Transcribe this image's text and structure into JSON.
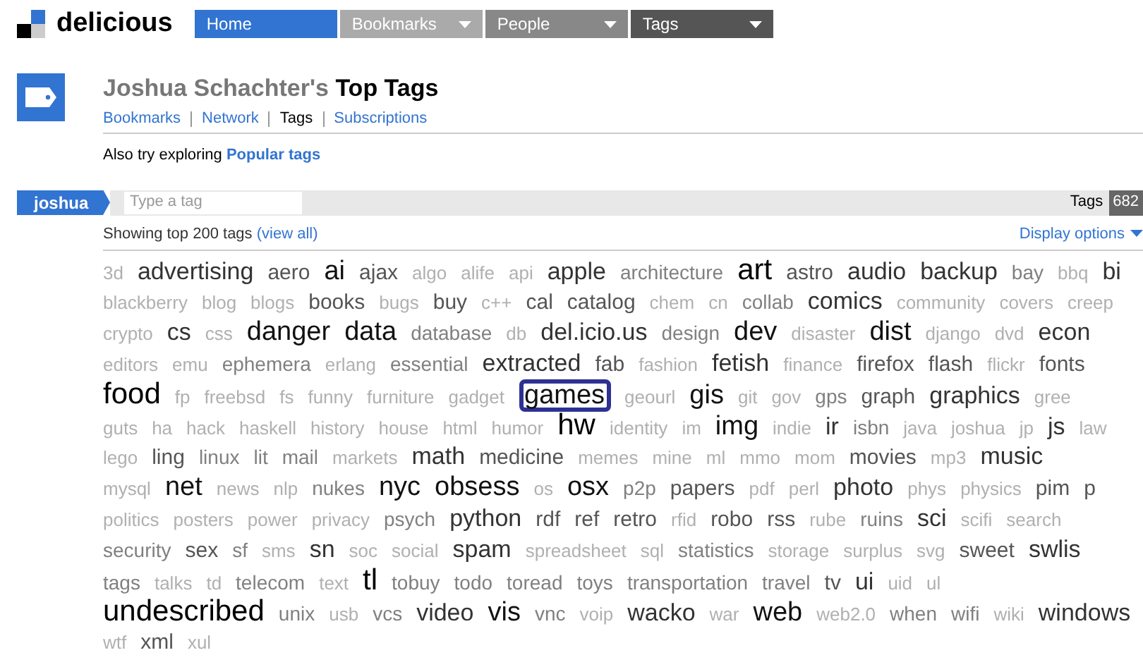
{
  "logo": {
    "text": "delicious"
  },
  "nav": [
    {
      "label": "Home",
      "selected": true,
      "menu": false
    },
    {
      "label": "Bookmarks",
      "selected": false,
      "menu": true
    },
    {
      "label": "People",
      "selected": false,
      "menu": true
    },
    {
      "label": "Tags",
      "selected": false,
      "menu": true
    }
  ],
  "profile": {
    "owner": "Joshua Schachter's",
    "title": "Top Tags"
  },
  "subnav": [
    {
      "label": "Bookmarks",
      "selected": false
    },
    {
      "label": "Network",
      "selected": false
    },
    {
      "label": "Tags",
      "selected": true
    },
    {
      "label": "Subscriptions",
      "selected": false
    }
  ],
  "explore": {
    "text": "Also try exploring",
    "link": "Popular tags"
  },
  "tagbar": {
    "user": "joshua",
    "placeholder": "Type a tag",
    "label": "Tags",
    "count": "682"
  },
  "summary": {
    "text": "Showing top 200 tags",
    "link": "(view all)",
    "options": "Display options"
  },
  "cloud_rows": [
    [
      {
        "text": "3d",
        "kind": "xs",
        "highlighted": false
      },
      {
        "text": "advertising",
        "kind": "l",
        "highlighted": false
      },
      {
        "text": "aero",
        "kind": "m",
        "highlighted": false
      },
      {
        "text": "ai",
        "kind": "xl",
        "highlighted": false
      },
      {
        "text": "ajax",
        "kind": "m",
        "highlighted": false
      },
      {
        "text": "algo",
        "kind": "xs",
        "highlighted": false
      },
      {
        "text": "alife",
        "kind": "xs",
        "highlighted": false
      },
      {
        "text": "api",
        "kind": "xs",
        "highlighted": false
      },
      {
        "text": "apple",
        "kind": "l",
        "highlighted": false
      },
      {
        "text": "architecture",
        "kind": "s",
        "highlighted": false
      },
      {
        "text": "art",
        "kind": "xxl",
        "highlighted": false
      },
      {
        "text": "astro",
        "kind": "m",
        "highlighted": false
      },
      {
        "text": "audio",
        "kind": "l",
        "highlighted": false
      },
      {
        "text": "backup",
        "kind": "l",
        "highlighted": false
      },
      {
        "text": "bay",
        "kind": "s",
        "highlighted": false
      },
      {
        "text": "bbq",
        "kind": "xs",
        "highlighted": false
      },
      {
        "text": "bi",
        "kind": "l",
        "highlighted": false
      }
    ],
    [
      {
        "text": "blackberry",
        "kind": "xs",
        "highlighted": false
      },
      {
        "text": "blog",
        "kind": "xs",
        "highlighted": false
      },
      {
        "text": "blogs",
        "kind": "xs",
        "highlighted": false
      },
      {
        "text": "books",
        "kind": "m",
        "highlighted": false
      },
      {
        "text": "bugs",
        "kind": "xs",
        "highlighted": false
      },
      {
        "text": "buy",
        "kind": "m",
        "highlighted": false
      },
      {
        "text": "c++",
        "kind": "xs",
        "highlighted": false
      },
      {
        "text": "cal",
        "kind": "m",
        "highlighted": false
      },
      {
        "text": "catalog",
        "kind": "m",
        "highlighted": false
      },
      {
        "text": "chem",
        "kind": "xs",
        "highlighted": false
      },
      {
        "text": "cn",
        "kind": "xs",
        "highlighted": false
      },
      {
        "text": "collab",
        "kind": "s",
        "highlighted": false
      },
      {
        "text": "comics",
        "kind": "l",
        "highlighted": false
      },
      {
        "text": "community",
        "kind": "xs",
        "highlighted": false
      },
      {
        "text": "covers",
        "kind": "xs",
        "highlighted": false
      },
      {
        "text": "creep",
        "kind": "xs",
        "highlighted": false
      }
    ],
    [
      {
        "text": "crypto",
        "kind": "xs",
        "highlighted": false
      },
      {
        "text": "cs",
        "kind": "l",
        "highlighted": false
      },
      {
        "text": "css",
        "kind": "xs",
        "highlighted": false
      },
      {
        "text": "danger",
        "kind": "xl",
        "highlighted": false
      },
      {
        "text": "data",
        "kind": "xl",
        "highlighted": false
      },
      {
        "text": "database",
        "kind": "s",
        "highlighted": false
      },
      {
        "text": "db",
        "kind": "xs",
        "highlighted": false
      },
      {
        "text": "del.icio.us",
        "kind": "l",
        "highlighted": false
      },
      {
        "text": "design",
        "kind": "s",
        "highlighted": false
      },
      {
        "text": "dev",
        "kind": "xl",
        "highlighted": false
      },
      {
        "text": "disaster",
        "kind": "xs",
        "highlighted": false
      },
      {
        "text": "dist",
        "kind": "xl",
        "highlighted": false
      },
      {
        "text": "django",
        "kind": "xs",
        "highlighted": false
      },
      {
        "text": "dvd",
        "kind": "xs",
        "highlighted": false
      },
      {
        "text": "econ",
        "kind": "l",
        "highlighted": false
      }
    ],
    [
      {
        "text": "editors",
        "kind": "xs",
        "highlighted": false
      },
      {
        "text": "emu",
        "kind": "xs",
        "highlighted": false
      },
      {
        "text": "ephemera",
        "kind": "s",
        "highlighted": false
      },
      {
        "text": "erlang",
        "kind": "xs",
        "highlighted": false
      },
      {
        "text": "essential",
        "kind": "s",
        "highlighted": false
      },
      {
        "text": "extracted",
        "kind": "l",
        "highlighted": false
      },
      {
        "text": "fab",
        "kind": "m",
        "highlighted": false
      },
      {
        "text": "fashion",
        "kind": "xs",
        "highlighted": false
      },
      {
        "text": "fetish",
        "kind": "l",
        "highlighted": false
      },
      {
        "text": "finance",
        "kind": "xs",
        "highlighted": false
      },
      {
        "text": "firefox",
        "kind": "m",
        "highlighted": false
      },
      {
        "text": "flash",
        "kind": "m",
        "highlighted": false
      },
      {
        "text": "flickr",
        "kind": "xs",
        "highlighted": false
      },
      {
        "text": "fonts",
        "kind": "m",
        "highlighted": false
      }
    ],
    [
      {
        "text": "food",
        "kind": "xxl",
        "highlighted": false
      },
      {
        "text": "fp",
        "kind": "xs",
        "highlighted": false
      },
      {
        "text": "freebsd",
        "kind": "xs",
        "highlighted": false
      },
      {
        "text": "fs",
        "kind": "xs",
        "highlighted": false
      },
      {
        "text": "funny",
        "kind": "xs",
        "highlighted": false
      },
      {
        "text": "furniture",
        "kind": "xs",
        "highlighted": false
      },
      {
        "text": "gadget",
        "kind": "xs",
        "highlighted": false
      },
      {
        "text": "games",
        "kind": "xl",
        "highlighted": true
      },
      {
        "text": "geourl",
        "kind": "xs",
        "highlighted": false
      },
      {
        "text": "gis",
        "kind": "xl",
        "highlighted": false
      },
      {
        "text": "git",
        "kind": "xs",
        "highlighted": false
      },
      {
        "text": "gov",
        "kind": "xs",
        "highlighted": false
      },
      {
        "text": "gps",
        "kind": "s",
        "highlighted": false
      },
      {
        "text": "graph",
        "kind": "m",
        "highlighted": false
      },
      {
        "text": "graphics",
        "kind": "l",
        "highlighted": false
      },
      {
        "text": "gree",
        "kind": "xs",
        "highlighted": false
      }
    ],
    [
      {
        "text": "guts",
        "kind": "xs",
        "highlighted": false
      },
      {
        "text": "ha",
        "kind": "xs",
        "highlighted": false
      },
      {
        "text": "hack",
        "kind": "xs",
        "highlighted": false
      },
      {
        "text": "haskell",
        "kind": "xs",
        "highlighted": false
      },
      {
        "text": "history",
        "kind": "xs",
        "highlighted": false
      },
      {
        "text": "house",
        "kind": "xs",
        "highlighted": false
      },
      {
        "text": "html",
        "kind": "xs",
        "highlighted": false
      },
      {
        "text": "humor",
        "kind": "xs",
        "highlighted": false
      },
      {
        "text": "hw",
        "kind": "xxl",
        "highlighted": false
      },
      {
        "text": "identity",
        "kind": "xs",
        "highlighted": false
      },
      {
        "text": "im",
        "kind": "xs",
        "highlighted": false
      },
      {
        "text": "img",
        "kind": "xl",
        "highlighted": false
      },
      {
        "text": "indie",
        "kind": "xs",
        "highlighted": false
      },
      {
        "text": "ir",
        "kind": "l",
        "highlighted": false
      },
      {
        "text": "isbn",
        "kind": "s",
        "highlighted": false
      },
      {
        "text": "java",
        "kind": "xs",
        "highlighted": false
      },
      {
        "text": "joshua",
        "kind": "xs",
        "highlighted": false
      },
      {
        "text": "jp",
        "kind": "xs",
        "highlighted": false
      },
      {
        "text": "js",
        "kind": "l",
        "highlighted": false
      },
      {
        "text": "law",
        "kind": "xs",
        "highlighted": false
      }
    ],
    [
      {
        "text": "lego",
        "kind": "xs",
        "highlighted": false
      },
      {
        "text": "ling",
        "kind": "m",
        "highlighted": false
      },
      {
        "text": "linux",
        "kind": "s",
        "highlighted": false
      },
      {
        "text": "lit",
        "kind": "s",
        "highlighted": false
      },
      {
        "text": "mail",
        "kind": "s",
        "highlighted": false
      },
      {
        "text": "markets",
        "kind": "xs",
        "highlighted": false
      },
      {
        "text": "math",
        "kind": "l",
        "highlighted": false
      },
      {
        "text": "medicine",
        "kind": "m",
        "highlighted": false
      },
      {
        "text": "memes",
        "kind": "xs",
        "highlighted": false
      },
      {
        "text": "mine",
        "kind": "xs",
        "highlighted": false
      },
      {
        "text": "ml",
        "kind": "xs",
        "highlighted": false
      },
      {
        "text": "mmo",
        "kind": "xs",
        "highlighted": false
      },
      {
        "text": "mom",
        "kind": "xs",
        "highlighted": false
      },
      {
        "text": "movies",
        "kind": "m",
        "highlighted": false
      },
      {
        "text": "mp3",
        "kind": "xs",
        "highlighted": false
      },
      {
        "text": "music",
        "kind": "l",
        "highlighted": false
      }
    ],
    [
      {
        "text": "mysql",
        "kind": "xs",
        "highlighted": false
      },
      {
        "text": "net",
        "kind": "xl",
        "highlighted": false
      },
      {
        "text": "news",
        "kind": "xs",
        "highlighted": false
      },
      {
        "text": "nlp",
        "kind": "xs",
        "highlighted": false
      },
      {
        "text": "nukes",
        "kind": "s",
        "highlighted": false
      },
      {
        "text": "nyc",
        "kind": "xl",
        "highlighted": false
      },
      {
        "text": "obsess",
        "kind": "xl",
        "highlighted": false
      },
      {
        "text": "os",
        "kind": "xs",
        "highlighted": false
      },
      {
        "text": "osx",
        "kind": "xl",
        "highlighted": false
      },
      {
        "text": "p2p",
        "kind": "s",
        "highlighted": false
      },
      {
        "text": "papers",
        "kind": "m",
        "highlighted": false
      },
      {
        "text": "pdf",
        "kind": "xs",
        "highlighted": false
      },
      {
        "text": "perl",
        "kind": "xs",
        "highlighted": false
      },
      {
        "text": "photo",
        "kind": "l",
        "highlighted": false
      },
      {
        "text": "phys",
        "kind": "xs",
        "highlighted": false
      },
      {
        "text": "physics",
        "kind": "xs",
        "highlighted": false
      },
      {
        "text": "pim",
        "kind": "m",
        "highlighted": false
      },
      {
        "text": "p",
        "kind": "m",
        "highlighted": false
      }
    ],
    [
      {
        "text": "politics",
        "kind": "xs",
        "highlighted": false
      },
      {
        "text": "posters",
        "kind": "xs",
        "highlighted": false
      },
      {
        "text": "power",
        "kind": "xs",
        "highlighted": false
      },
      {
        "text": "privacy",
        "kind": "xs",
        "highlighted": false
      },
      {
        "text": "psych",
        "kind": "s",
        "highlighted": false
      },
      {
        "text": "python",
        "kind": "l",
        "highlighted": false
      },
      {
        "text": "rdf",
        "kind": "m",
        "highlighted": false
      },
      {
        "text": "ref",
        "kind": "m",
        "highlighted": false
      },
      {
        "text": "retro",
        "kind": "m",
        "highlighted": false
      },
      {
        "text": "rfid",
        "kind": "xs",
        "highlighted": false
      },
      {
        "text": "robo",
        "kind": "m",
        "highlighted": false
      },
      {
        "text": "rss",
        "kind": "m",
        "highlighted": false
      },
      {
        "text": "rube",
        "kind": "xs",
        "highlighted": false
      },
      {
        "text": "ruins",
        "kind": "s",
        "highlighted": false
      },
      {
        "text": "sci",
        "kind": "l",
        "highlighted": false
      },
      {
        "text": "scifi",
        "kind": "xs",
        "highlighted": false
      },
      {
        "text": "search",
        "kind": "xs",
        "highlighted": false
      }
    ],
    [
      {
        "text": "security",
        "kind": "s",
        "highlighted": false
      },
      {
        "text": "sex",
        "kind": "m",
        "highlighted": false
      },
      {
        "text": "sf",
        "kind": "s",
        "highlighted": false
      },
      {
        "text": "sms",
        "kind": "xs",
        "highlighted": false
      },
      {
        "text": "sn",
        "kind": "l",
        "highlighted": false
      },
      {
        "text": "soc",
        "kind": "xs",
        "highlighted": false
      },
      {
        "text": "social",
        "kind": "xs",
        "highlighted": false
      },
      {
        "text": "spam",
        "kind": "l",
        "highlighted": false
      },
      {
        "text": "spreadsheet",
        "kind": "xs",
        "highlighted": false
      },
      {
        "text": "sql",
        "kind": "xs",
        "highlighted": false
      },
      {
        "text": "statistics",
        "kind": "s",
        "highlighted": false
      },
      {
        "text": "storage",
        "kind": "xs",
        "highlighted": false
      },
      {
        "text": "surplus",
        "kind": "xs",
        "highlighted": false
      },
      {
        "text": "svg",
        "kind": "xs",
        "highlighted": false
      },
      {
        "text": "sweet",
        "kind": "m",
        "highlighted": false
      },
      {
        "text": "swlis",
        "kind": "l",
        "highlighted": false
      }
    ],
    [
      {
        "text": "tags",
        "kind": "s",
        "highlighted": false
      },
      {
        "text": "talks",
        "kind": "xs",
        "highlighted": false
      },
      {
        "text": "td",
        "kind": "xs",
        "highlighted": false
      },
      {
        "text": "telecom",
        "kind": "s",
        "highlighted": false
      },
      {
        "text": "text",
        "kind": "xs",
        "highlighted": false
      },
      {
        "text": "tl",
        "kind": "xxl",
        "highlighted": false
      },
      {
        "text": "tobuy",
        "kind": "s",
        "highlighted": false
      },
      {
        "text": "todo",
        "kind": "s",
        "highlighted": false
      },
      {
        "text": "toread",
        "kind": "s",
        "highlighted": false
      },
      {
        "text": "toys",
        "kind": "s",
        "highlighted": false
      },
      {
        "text": "transportation",
        "kind": "s",
        "highlighted": false
      },
      {
        "text": "travel",
        "kind": "s",
        "highlighted": false
      },
      {
        "text": "tv",
        "kind": "m",
        "highlighted": false
      },
      {
        "text": "ui",
        "kind": "l",
        "highlighted": false
      },
      {
        "text": "uid",
        "kind": "xs",
        "highlighted": false
      },
      {
        "text": "ul",
        "kind": "xs",
        "highlighted": false
      }
    ],
    [
      {
        "text": "undescribed",
        "kind": "xxl",
        "highlighted": false
      },
      {
        "text": "unix",
        "kind": "s",
        "highlighted": false
      },
      {
        "text": "usb",
        "kind": "xs",
        "highlighted": false
      },
      {
        "text": "vcs",
        "kind": "s",
        "highlighted": false
      },
      {
        "text": "video",
        "kind": "l",
        "highlighted": false
      },
      {
        "text": "vis",
        "kind": "xl",
        "highlighted": false
      },
      {
        "text": "vnc",
        "kind": "s",
        "highlighted": false
      },
      {
        "text": "voip",
        "kind": "xs",
        "highlighted": false
      },
      {
        "text": "wacko",
        "kind": "l",
        "highlighted": false
      },
      {
        "text": "war",
        "kind": "xs",
        "highlighted": false
      },
      {
        "text": "web",
        "kind": "xl",
        "highlighted": false
      },
      {
        "text": "web2.0",
        "kind": "xs",
        "highlighted": false
      },
      {
        "text": "when",
        "kind": "s",
        "highlighted": false
      },
      {
        "text": "wifi",
        "kind": "s",
        "highlighted": false
      },
      {
        "text": "wiki",
        "kind": "xs",
        "highlighted": false
      },
      {
        "text": "windows",
        "kind": "l",
        "highlighted": false
      }
    ],
    [
      {
        "text": "wtf",
        "kind": "xs",
        "highlighted": false
      },
      {
        "text": "xml",
        "kind": "m",
        "highlighted": false
      },
      {
        "text": "xul",
        "kind": "xs",
        "highlighted": false
      }
    ]
  ]
}
